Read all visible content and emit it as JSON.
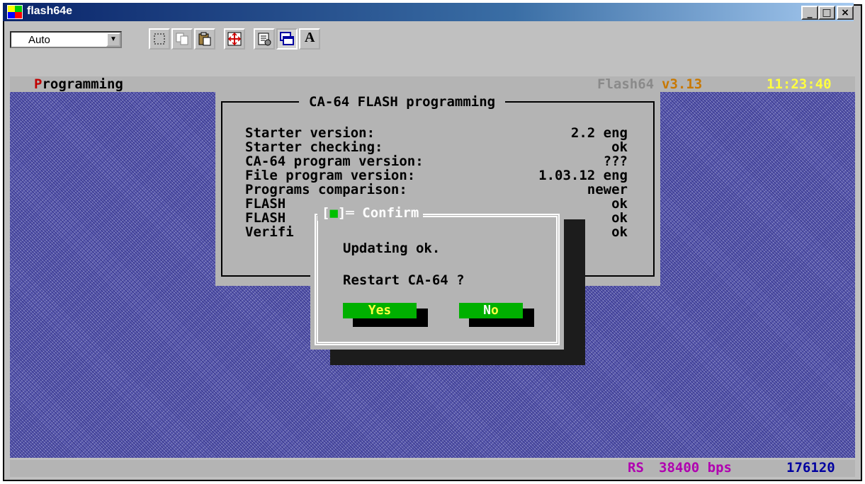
{
  "window": {
    "title": "flash64e",
    "app_icon": "ms-dos-icon"
  },
  "title_buttons": {
    "minimize": "_",
    "maximize": "□",
    "close": "×"
  },
  "toolbar": {
    "font_size_combo": "Auto",
    "buttons": [
      "mark-icon",
      "copy-icon",
      "paste-icon",
      "full-screen-icon",
      "properties-icon",
      "background-icon",
      "font-icon"
    ],
    "font_button_label": "A"
  },
  "status_top": {
    "mode": "Programming",
    "mode_first_letter": "P",
    "mode_rest": "rogramming",
    "app": "Flash64",
    "version": "v3.13",
    "time": "11:23:40"
  },
  "panel": {
    "title": "CA-64 FLASH programming",
    "rows": [
      {
        "label": "Starter version:",
        "value": "2.2 eng"
      },
      {
        "label": "Starter checking:",
        "value": "ok"
      },
      {
        "label": "CA-64 program version:",
        "value": "???"
      },
      {
        "label": "File program version:",
        "value": "1.03.12 eng"
      },
      {
        "label": "Programs comparison:",
        "value": "newer"
      },
      {
        "label": "FLASH",
        "value": "ok"
      },
      {
        "label": "FLASH",
        "value": "ok"
      },
      {
        "label": "Verifi",
        "value": "ok"
      }
    ]
  },
  "dialog": {
    "title": "Confirm",
    "close_left": "[",
    "close_mark": "■",
    "close_right": "]═",
    "message1": "Updating ok.",
    "message2": "Restart CA-64 ?",
    "yes": "Yes",
    "no_first": "N",
    "no_rest": "o"
  },
  "status_bottom": {
    "port": "RS",
    "speed": "38400 bps",
    "count": "176120"
  },
  "colors": {
    "terminal_bg": "#5a5ab0",
    "panel_bg": "#b4b4b4",
    "button_green": "#00b000",
    "accent_orange": "#c87800",
    "time_yellow": "#ffff40",
    "status_magenta": "#b000b0",
    "count_blue": "#0000a0"
  }
}
